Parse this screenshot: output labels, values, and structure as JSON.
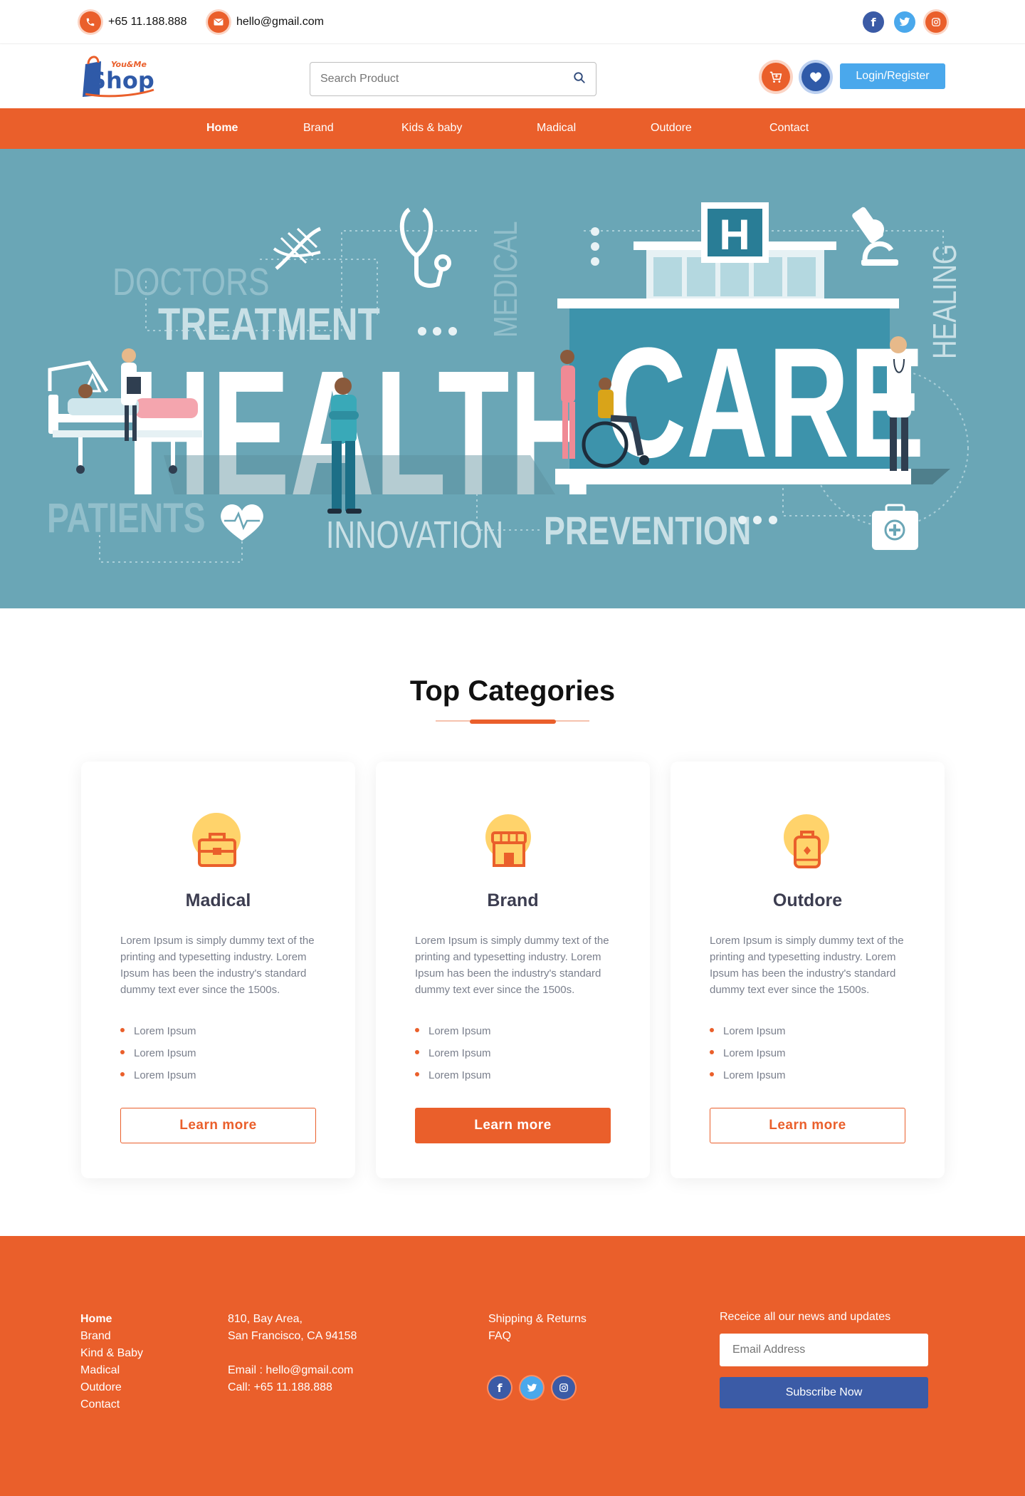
{
  "topbar": {
    "phone": "+65 11.188.888",
    "email": "hello@gmail.com",
    "socials": [
      {
        "icon": "facebook-icon",
        "glyph": "f",
        "color": "#3b5ba6"
      },
      {
        "icon": "twitter-icon",
        "glyph": "t",
        "color": "#4aa8ec"
      },
      {
        "icon": "instagram-icon",
        "glyph": "◎",
        "color": "#ea5f2b"
      }
    ]
  },
  "header": {
    "logo_small": "You&Me",
    "logo_main": "Shop",
    "search_placeholder": "Search Product",
    "login_label": "Login/Register"
  },
  "nav": {
    "items": [
      "Home",
      "Brand",
      "Kids & baby",
      "Madical",
      "Outdore",
      "Contact"
    ],
    "active": "Home"
  },
  "hero": {
    "words": {
      "doctors": "DOCTORS",
      "treatment": "TREATMENT",
      "medical": "MEDICAL",
      "health": "HEALTH",
      "care": "CARE",
      "healing": "HEALING",
      "patients": "PATIENTS",
      "innovation": "INNOVATION",
      "prevention": "PREVENTION",
      "h": "H"
    }
  },
  "categories": {
    "title": "Top Categories",
    "cards": [
      {
        "icon": "briefcase-icon",
        "title": "Madical",
        "text": "Lorem Ipsum is simply dummy text of the printing and typesetting industry. Lorem Ipsum has been the industry's standard dummy text ever since the 1500s.",
        "bullets": [
          "Lorem Ipsum",
          "Lorem Ipsum",
          "Lorem Ipsum"
        ],
        "button": "Learn more"
      },
      {
        "icon": "store-icon",
        "title": "Brand",
        "text": "Lorem Ipsum is simply dummy text of the printing and typesetting industry. Lorem Ipsum has been the industry's standard dummy text ever since the 1500s.",
        "bullets": [
          "Lorem Ipsum",
          "Lorem Ipsum",
          "Lorem Ipsum"
        ],
        "button": "Learn more"
      },
      {
        "icon": "backpack-icon",
        "title": "Outdore",
        "text": "Lorem Ipsum is simply dummy text of the printing and typesetting industry. Lorem Ipsum has been the industry's standard dummy text ever since the 1500s.",
        "bullets": [
          "Lorem Ipsum",
          "Lorem Ipsum",
          "Lorem Ipsum"
        ],
        "button": "Learn more"
      }
    ]
  },
  "footer": {
    "links": [
      "Home",
      "Brand",
      "Kind & Baby",
      "Madical",
      "Outdore",
      "Contact"
    ],
    "address_line1": "810, Bay Area,",
    "address_line2": "San Francisco, CA 94158",
    "email_line": "Email : hello@gmail.com",
    "call_line": "Call: +65 11.188.888",
    "info_links": [
      "Shipping & Returns",
      "FAQ"
    ],
    "newsletter_label": "Receice all our news and updates",
    "email_placeholder": "Email Address",
    "subscribe_label": "Subscribe Now"
  },
  "colors": {
    "accent": "#ea5f2b",
    "hero_bg": "#6aa6b6",
    "login": "#4aa8ec",
    "subscribe": "#3b5ba6"
  }
}
